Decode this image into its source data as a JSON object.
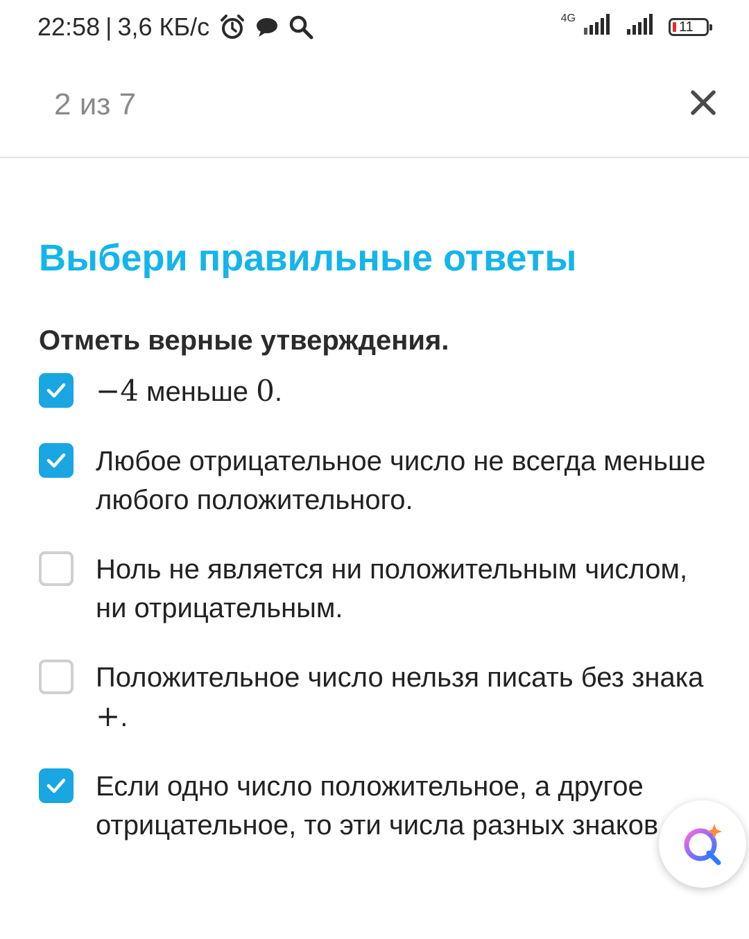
{
  "status_bar": {
    "time": "22:58",
    "separator": "|",
    "speed": "3,6 КБ/с",
    "network": "4G",
    "battery": "11"
  },
  "header": {
    "progress": "2 из 7"
  },
  "task": {
    "title": "Выбери правильные ответы",
    "instruction": "Отметь верные утверждения."
  },
  "options": [
    {
      "checked": true,
      "math_a": "−4",
      "text_a": " меньше ",
      "math_b": "0",
      "text_b": "."
    },
    {
      "checked": true,
      "text": "Любое отрицательное число не всегда меньше любого положительного."
    },
    {
      "checked": false,
      "text": "Ноль не является ни положительным числом, ни отрицательным."
    },
    {
      "checked": false,
      "text_a": "Положительное число нельзя писать без знака ",
      "math_a": "+",
      "text_b": "."
    },
    {
      "checked": true,
      "text": "Если одно число положительное, а другое отрицательное, то эти числа разных знаков."
    }
  ],
  "colors": {
    "accent": "#13b5ea",
    "checkbox_checked": "#1aa6e0",
    "checkbox_unchecked_border": "#cfcfcf"
  },
  "icons": {
    "alarm": "alarm-icon",
    "chat": "chat-icon",
    "search": "search-icon",
    "close": "close-icon",
    "assistant": "assistant-icon"
  }
}
